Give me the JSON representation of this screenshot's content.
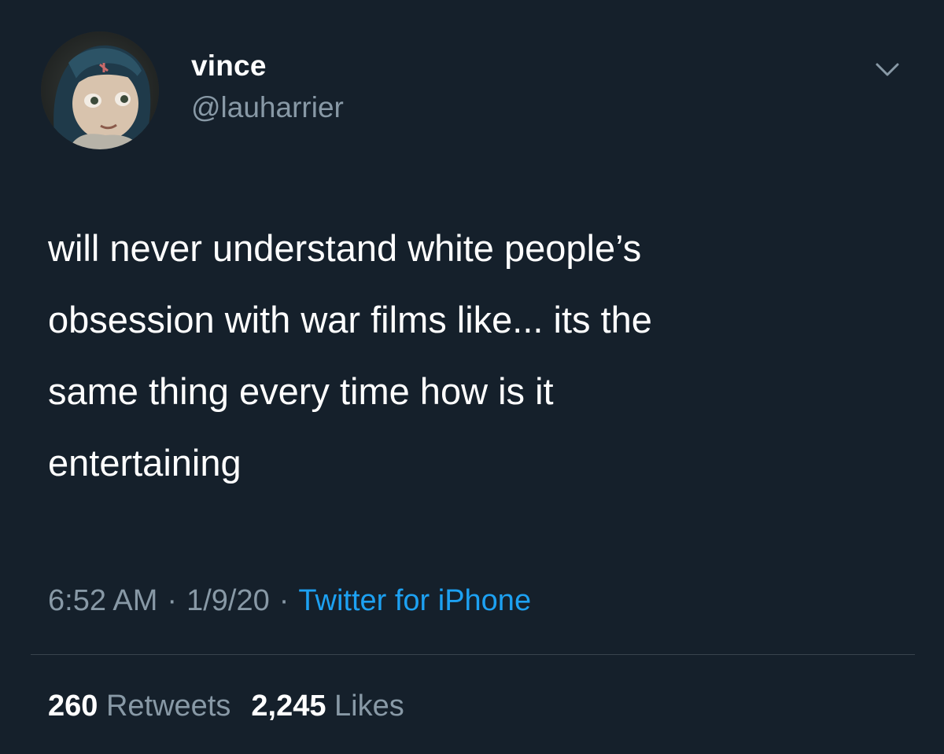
{
  "tweet": {
    "user": {
      "name": "vince",
      "handle": "@lauharrier",
      "avatar_icon": "profile-avatar"
    },
    "menu_icon": "chevron-down-icon",
    "text": "will never understand white people’s\nobsession with war films like... its the\nsame thing every time how is it\nentertaining",
    "meta": {
      "time": "6:52 AM",
      "separator": "·",
      "date": "1/9/20",
      "source": "Twitter for iPhone"
    },
    "stats": {
      "retweets_count": "260",
      "retweets_label": "Retweets",
      "likes_count": "2,245",
      "likes_label": "Likes"
    }
  },
  "colors": {
    "background": "#15202b",
    "text_primary": "#ffffff",
    "text_secondary": "#8899a6",
    "link": "#1da1f2",
    "divider": "#38444d"
  }
}
